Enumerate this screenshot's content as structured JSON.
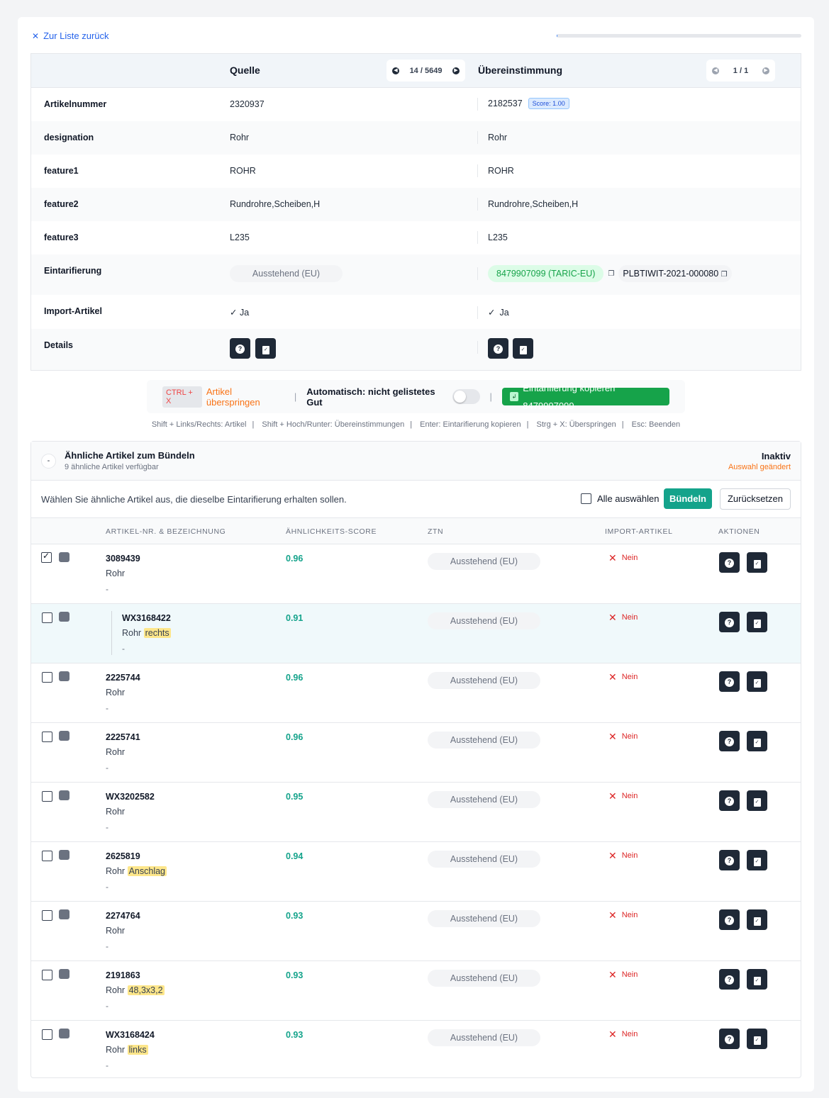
{
  "nav": {
    "back_label": "Zur Liste zurück",
    "close_icon": "close-icon",
    "progress": 0.0025
  },
  "compare": {
    "source_header": "Quelle",
    "match_header": "Übereinstimmung",
    "source_pager": "14 / 5649",
    "match_pager": "1 / 1",
    "rows": [
      {
        "label": "Artikelnummer",
        "source": "2320937",
        "match": "2182537",
        "match_badge": "Score: 1.00"
      },
      {
        "label": "designation",
        "source": "Rohr",
        "match": "Rohr"
      },
      {
        "label": "feature1",
        "source": "ROHR",
        "match": "ROHR"
      },
      {
        "label": "feature2",
        "source": "Rundrohre,Scheiben,H",
        "match": "Rundrohre,Scheiben,H"
      },
      {
        "label": "feature3",
        "source": "L235",
        "match": "L235"
      }
    ],
    "tariff": {
      "label": "Eintarifierung",
      "source": "Ausstehend (EU)",
      "match_code": "8479907099 (TARIC-EU)",
      "match_ref": "PLBTIWIT-2021-000080"
    },
    "import": {
      "label": "Import-Artikel",
      "source": "Ja",
      "match": "Ja"
    },
    "details": {
      "label": "Details"
    }
  },
  "actionbar": {
    "skip_kbd": "CTRL + X",
    "skip_label": "Artikel überspringen",
    "auto_label": "Automatisch: nicht gelistetes Gut",
    "auto_enabled": false,
    "copy_label": "Eintarifierung kopieren 8479907099"
  },
  "shortcuts": [
    "Shift + Links/Rechts: Artikel",
    "Shift + Hoch/Runter: Übereinstimmungen",
    "Enter: Eintarifierung kopieren",
    "Strg + X: Überspringen",
    "Esc: Beenden"
  ],
  "similar": {
    "collapse_symbol": "-",
    "title": "Ähnliche Artikel zum Bündeln",
    "subtitle": "9 ähnliche Artikel verfügbar",
    "status": "Inaktiv",
    "status_note": "Auswahl geändert",
    "description": "Wählen Sie ähnliche Artikel aus, die dieselbe Eintarifierung erhalten sollen.",
    "select_all": "Alle auswählen",
    "bundle_label": "Bündeln",
    "reset_label": "Zurücksetzen",
    "columns": [
      "Artikel-Nr. & Bezeichnung",
      "Ähnlichkeits-Score",
      "ZTN",
      "Import-Artikel",
      "Aktionen"
    ],
    "rows": [
      {
        "number": "3089439",
        "name": "Rohr",
        "highlight": "",
        "extra": "-",
        "score": "0.96",
        "ztn": "Ausstehend (EU)",
        "import": "Nein",
        "checked": true,
        "child": false
      },
      {
        "number": "WX3168422",
        "name": "Rohr",
        "highlight": "rechts",
        "extra": "-",
        "score": "0.91",
        "ztn": "Ausstehend (EU)",
        "import": "Nein",
        "checked": false,
        "child": true
      },
      {
        "number": "2225744",
        "name": "Rohr",
        "highlight": "",
        "extra": "-",
        "score": "0.96",
        "ztn": "Ausstehend (EU)",
        "import": "Nein",
        "checked": false,
        "child": false
      },
      {
        "number": "2225741",
        "name": "Rohr",
        "highlight": "",
        "extra": "-",
        "score": "0.96",
        "ztn": "Ausstehend (EU)",
        "import": "Nein",
        "checked": false,
        "child": false
      },
      {
        "number": "WX3202582",
        "name": "Rohr",
        "highlight": "",
        "extra": "-",
        "score": "0.95",
        "ztn": "Ausstehend (EU)",
        "import": "Nein",
        "checked": false,
        "child": false
      },
      {
        "number": "2625819",
        "name": "Rohr",
        "highlight": "Anschlag",
        "extra": "-",
        "score": "0.94",
        "ztn": "Ausstehend (EU)",
        "import": "Nein",
        "checked": false,
        "child": false
      },
      {
        "number": "2274764",
        "name": "Rohr",
        "highlight": "",
        "extra": "-",
        "score": "0.93",
        "ztn": "Ausstehend (EU)",
        "import": "Nein",
        "checked": false,
        "child": false
      },
      {
        "number": "2191863",
        "name": "Rohr",
        "highlight": "48,3x3,2",
        "extra": "-",
        "score": "0.93",
        "ztn": "Ausstehend (EU)",
        "import": "Nein",
        "checked": false,
        "child": false
      },
      {
        "number": "WX3168424",
        "name": "Rohr",
        "highlight": "links",
        "extra": "-",
        "score": "0.93",
        "ztn": "Ausstehend (EU)",
        "import": "Nein",
        "checked": false,
        "child": false
      }
    ]
  },
  "colors": {
    "accent": "#14a38b",
    "link": "#2563eb",
    "warning": "#f97316",
    "danger": "#dc2626",
    "success": "#16a34a"
  }
}
